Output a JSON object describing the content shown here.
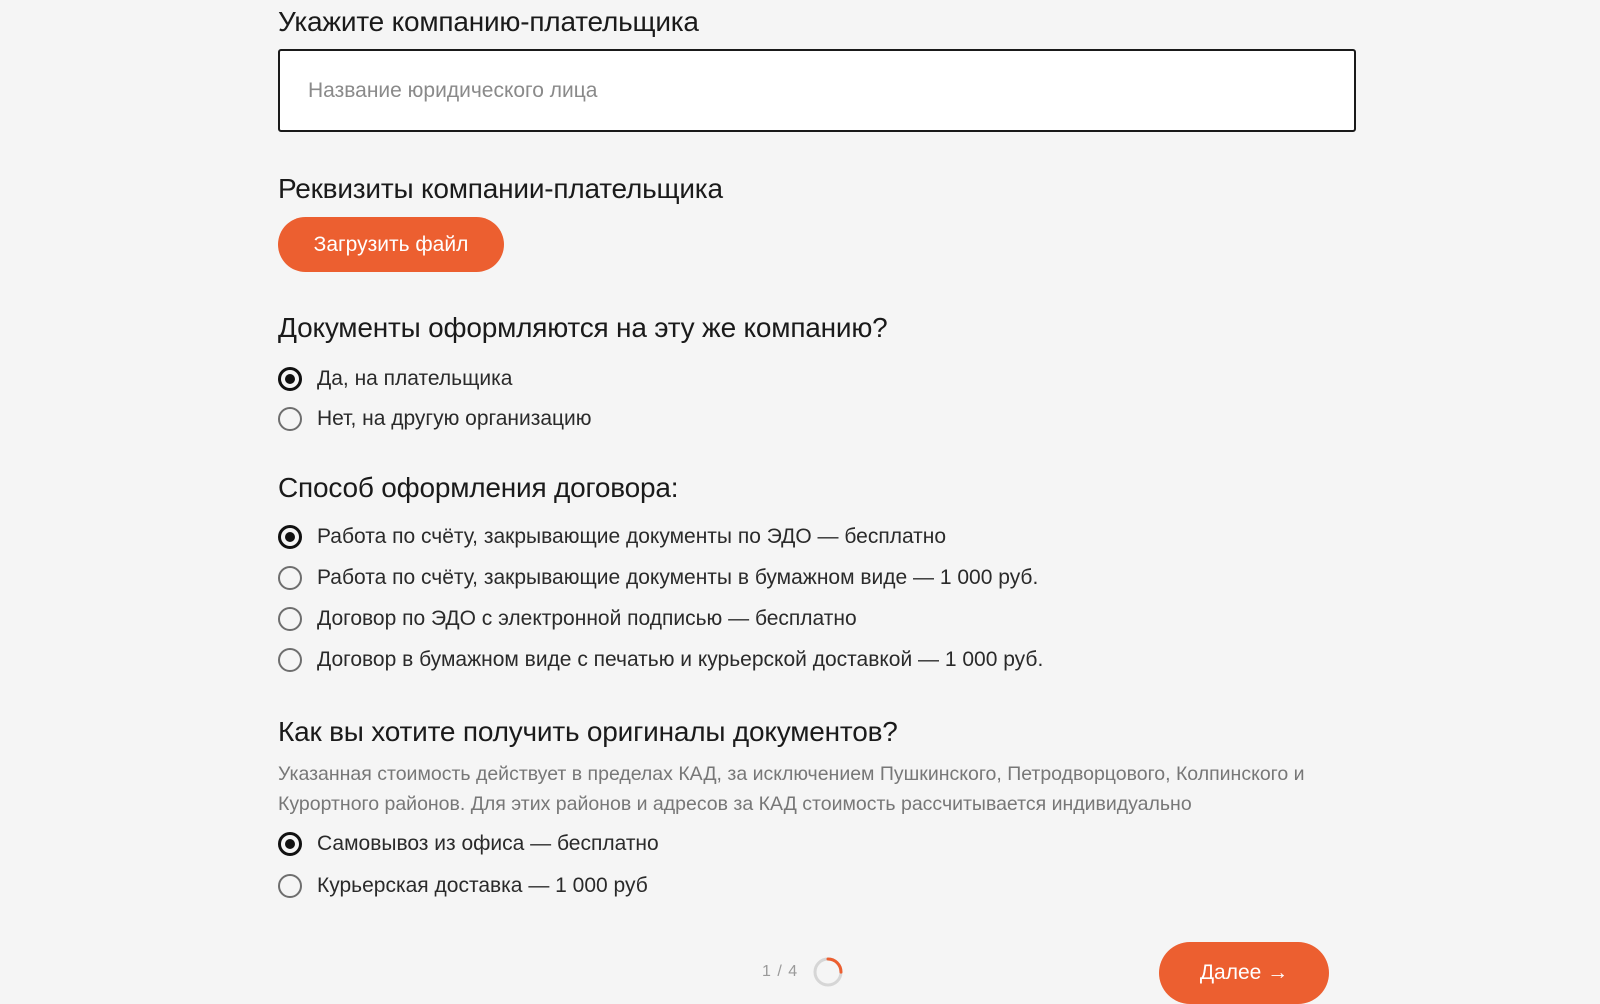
{
  "payer": {
    "heading": "Укажите компанию-плательщика",
    "input_placeholder": "Название юридического лица",
    "input_value": ""
  },
  "details": {
    "heading": "Реквизиты компании-плательщика",
    "upload_label": "Загрузить файл"
  },
  "documents": {
    "heading": "Документы оформляются на эту же компанию?",
    "options": [
      {
        "label": "Да, на плательщика",
        "checked": true
      },
      {
        "label": "Нет, на другую организацию",
        "checked": false
      }
    ]
  },
  "contract": {
    "heading": "Способ оформления договора:",
    "options": [
      {
        "label": "Работа по счёту, закрывающие документы по ЭДО — бесплатно",
        "checked": true
      },
      {
        "label": "Работа по счёту, закрывающие документы в бумажном виде — 1 000 руб.",
        "checked": false
      },
      {
        "label": "Договор по ЭДО с электронной подписью — бесплатно",
        "checked": false
      },
      {
        "label": "Договор в бумажном виде с печатью и курьерской доставкой — 1 000 руб.",
        "checked": false
      }
    ]
  },
  "originals": {
    "heading": "Как вы хотите получить оригиналы документов?",
    "note_line1": "Указанная стоимость действует в пределах КАД, за исключением Пушкинского, Петродворцового, Колпинского и",
    "note_line2": "Курортного районов. Для этих районов и адресов за КАД стоимость рассчитывается индивидуально",
    "options": [
      {
        "label": "Самовывоз из офиса — бесплатно",
        "checked": true
      },
      {
        "label": "Курьерская доставка — 1 000 руб",
        "checked": false
      }
    ]
  },
  "footer": {
    "pager_text": "1 / 4",
    "progress_fraction": 0.25,
    "next_label": "Далее →"
  },
  "colors": {
    "accent": "#ec5f30",
    "background": "#f5f5f5",
    "text": "#1a1a1a",
    "muted": "#777777"
  }
}
